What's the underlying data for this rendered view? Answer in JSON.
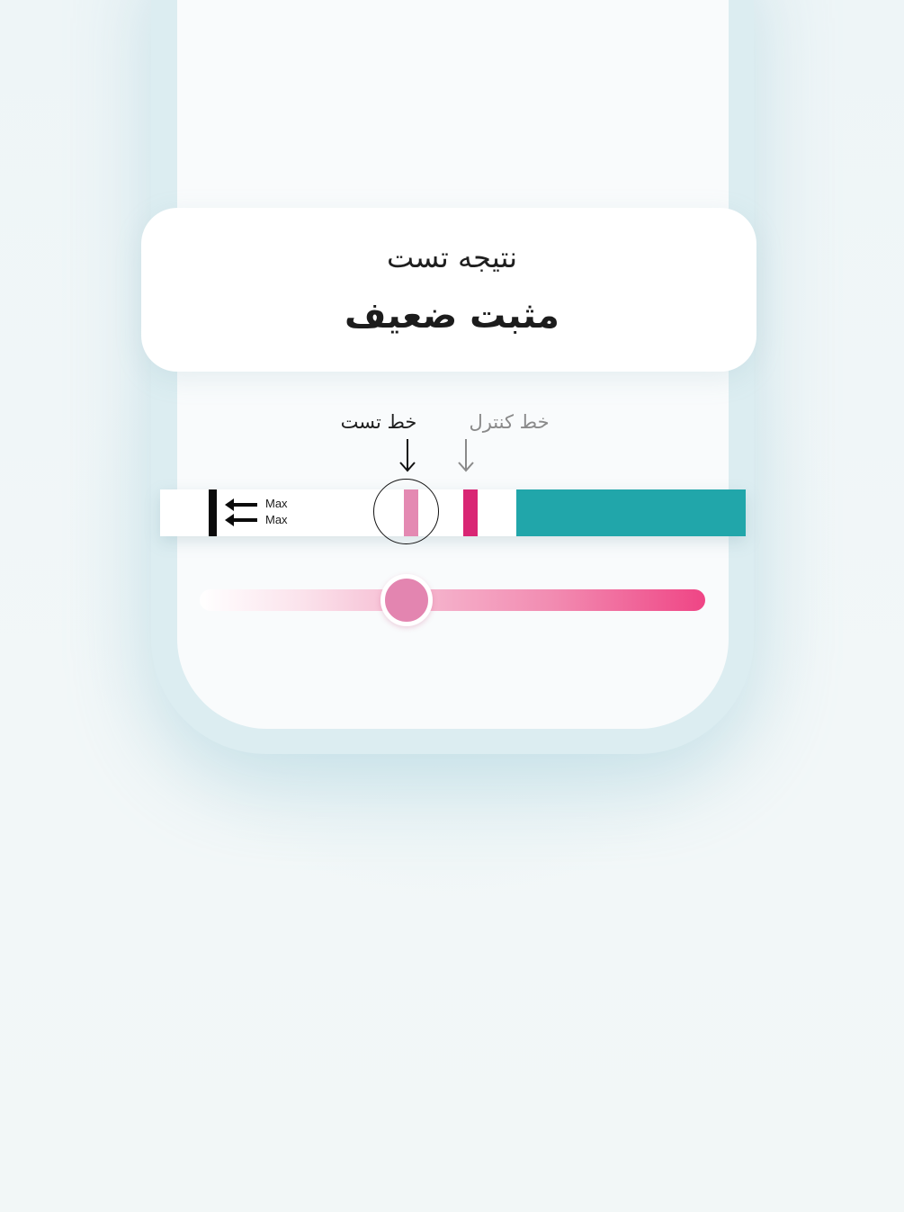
{
  "result": {
    "caption": "نتیجه تست",
    "value": "مثبت ضعیف"
  },
  "labels": {
    "test_line": "خط تست",
    "control_line": "خط کنترل"
  },
  "strip": {
    "max_top": "Max",
    "max_bottom": "Max",
    "test_line_color": "#e489b2",
    "control_line_color": "#d92674",
    "handle_color": "#21a6aa"
  },
  "intensity_slider": {
    "value_fraction": 0.41,
    "gradient_start": "#ffffff",
    "gradient_end": "#ef4585",
    "thumb_color": "#e385b0"
  },
  "icons": [
    "arrow-down-icon",
    "double-arrow-left-icon"
  ]
}
